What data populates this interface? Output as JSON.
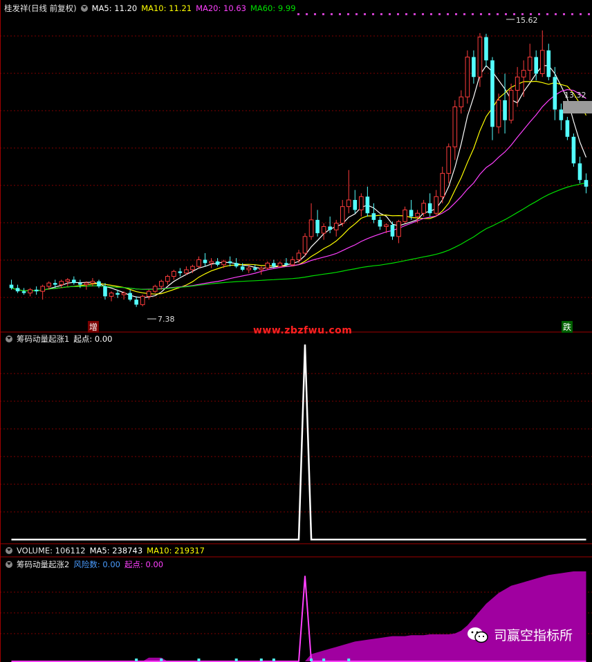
{
  "main_header": {
    "title": "桂发祥(日线 前复权)",
    "ma5_label": "MA5: 11.20",
    "ma10_label": "MA10: 11.21",
    "ma20_label": "MA20: 10.63",
    "ma60_label": "MA60: 9.99"
  },
  "annotations": {
    "high_label": "15.62",
    "low_label": "7.38",
    "price_label": "13.32",
    "up_tag": "增",
    "down_tag": "跌"
  },
  "watermark": "www.zbzfwu.com",
  "panel2_header": {
    "title": "筹码动量起涨1",
    "start_label": "起点: 0.00"
  },
  "panel3_header": {
    "volume_label": "VOLUME: 106112",
    "ma5_label": "MA5: 238743",
    "ma10_label": "MA10: 219317"
  },
  "panel4_header": {
    "title": "筹码动量起涨2",
    "risk_label": "风险数: 0.00",
    "start_label": "起点: 0.00"
  },
  "brand": "司赢空指标所",
  "colors": {
    "up": "#ff3c3c",
    "down": "#54ffff",
    "ma5": "#ffffff",
    "ma10": "#ffff00",
    "ma20": "#ff40ff",
    "ma60": "#00e000",
    "grid": "#800000",
    "signal": "#ffffff",
    "risk_fill": "#a000a0"
  },
  "chart_data": [
    {
      "type": "candlestick",
      "title": "桂发祥(日线 前复权)",
      "ylim": [
        7.0,
        16.2
      ],
      "candles": [
        [
          8.05,
          8.2,
          7.9,
          7.95
        ],
        [
          7.95,
          8.05,
          7.8,
          7.85
        ],
        [
          7.85,
          7.95,
          7.75,
          7.8
        ],
        [
          7.8,
          7.95,
          7.7,
          7.9
        ],
        [
          7.9,
          8.0,
          7.75,
          7.85
        ],
        [
          7.85,
          8.05,
          7.6,
          8.0
        ],
        [
          8.0,
          8.15,
          7.9,
          8.1
        ],
        [
          8.1,
          8.2,
          7.95,
          8.05
        ],
        [
          8.05,
          8.2,
          7.95,
          8.15
        ],
        [
          8.15,
          8.25,
          8.0,
          8.2
        ],
        [
          8.2,
          8.3,
          8.05,
          8.1
        ],
        [
          8.1,
          8.2,
          7.95,
          8.05
        ],
        [
          8.05,
          8.15,
          7.9,
          8.1
        ],
        [
          8.1,
          8.25,
          8.0,
          8.15
        ],
        [
          8.15,
          8.2,
          7.95,
          8.0
        ],
        [
          8.0,
          8.1,
          7.6,
          7.7
        ],
        [
          7.7,
          7.85,
          7.55,
          7.8
        ],
        [
          7.8,
          7.9,
          7.65,
          7.75
        ],
        [
          7.75,
          7.85,
          7.6,
          7.8
        ],
        [
          7.8,
          7.9,
          7.55,
          7.6
        ],
        [
          7.6,
          7.7,
          7.38,
          7.45
        ],
        [
          7.45,
          7.75,
          7.4,
          7.7
        ],
        [
          7.7,
          7.9,
          7.6,
          7.85
        ],
        [
          7.85,
          8.05,
          7.8,
          8.0
        ],
        [
          8.0,
          8.2,
          7.9,
          8.15
        ],
        [
          8.15,
          8.35,
          8.05,
          8.3
        ],
        [
          8.3,
          8.5,
          8.2,
          8.45
        ],
        [
          8.45,
          8.55,
          8.3,
          8.4
        ],
        [
          8.4,
          8.6,
          8.35,
          8.5
        ],
        [
          8.5,
          8.65,
          8.4,
          8.6
        ],
        [
          8.6,
          8.9,
          8.55,
          8.8
        ],
        [
          8.8,
          9.0,
          8.6,
          8.7
        ],
        [
          8.7,
          8.85,
          8.55,
          8.75
        ],
        [
          8.75,
          8.85,
          8.6,
          8.65
        ],
        [
          8.65,
          8.8,
          8.55,
          8.75
        ],
        [
          8.75,
          8.9,
          8.6,
          8.7
        ],
        [
          8.7,
          8.85,
          8.55,
          8.6
        ],
        [
          8.6,
          8.7,
          8.45,
          8.5
        ],
        [
          8.5,
          8.65,
          8.4,
          8.55
        ],
        [
          8.55,
          8.65,
          8.45,
          8.5
        ],
        [
          8.5,
          8.6,
          8.35,
          8.55
        ],
        [
          8.55,
          8.75,
          8.5,
          8.7
        ],
        [
          8.7,
          8.8,
          8.55,
          8.6
        ],
        [
          8.6,
          8.75,
          8.55,
          8.7
        ],
        [
          8.7,
          8.85,
          8.6,
          8.65
        ],
        [
          8.65,
          8.9,
          8.6,
          8.8
        ],
        [
          8.8,
          9.1,
          8.7,
          9.0
        ],
        [
          9.0,
          9.6,
          8.9,
          9.5
        ],
        [
          9.5,
          10.5,
          9.4,
          10.0
        ],
        [
          10.0,
          10.3,
          9.5,
          9.6
        ],
        [
          9.6,
          9.9,
          9.4,
          9.8
        ],
        [
          9.8,
          10.1,
          9.6,
          9.7
        ],
        [
          9.7,
          10.0,
          9.5,
          9.9
        ],
        [
          9.9,
          10.6,
          9.8,
          10.4
        ],
        [
          10.4,
          11.5,
          10.2,
          10.6
        ],
        [
          10.6,
          10.9,
          10.2,
          10.3
        ],
        [
          10.3,
          10.8,
          10.1,
          10.7
        ],
        [
          10.7,
          11.0,
          10.1,
          10.2
        ],
        [
          10.2,
          10.5,
          9.9,
          10.0
        ],
        [
          10.0,
          10.1,
          9.7,
          9.8
        ],
        [
          9.8,
          9.9,
          9.6,
          9.85
        ],
        [
          9.85,
          9.95,
          9.4,
          9.5
        ],
        [
          9.5,
          10.0,
          9.3,
          9.95
        ],
        [
          9.95,
          10.4,
          9.9,
          10.3
        ],
        [
          10.3,
          10.6,
          10.0,
          10.1
        ],
        [
          10.1,
          10.3,
          9.9,
          10.2
        ],
        [
          10.2,
          10.6,
          10.1,
          10.5
        ],
        [
          10.5,
          10.8,
          10.1,
          10.2
        ],
        [
          10.2,
          10.9,
          10.1,
          10.7
        ],
        [
          10.7,
          11.6,
          10.5,
          11.4
        ],
        [
          11.4,
          12.3,
          11.1,
          12.2
        ],
        [
          12.2,
          13.6,
          11.8,
          13.4
        ],
        [
          13.4,
          13.9,
          13.2,
          13.7
        ],
        [
          13.7,
          15.1,
          13.5,
          14.9
        ],
        [
          14.9,
          15.1,
          14.1,
          14.3
        ],
        [
          14.3,
          15.62,
          14.0,
          15.5
        ],
        [
          15.5,
          15.6,
          14.6,
          14.8
        ],
        [
          14.8,
          14.9,
          12.4,
          12.8
        ],
        [
          12.8,
          13.8,
          12.6,
          13.6
        ],
        [
          13.6,
          14.4,
          12.6,
          13.0
        ],
        [
          13.0,
          14.1,
          12.9,
          13.9
        ],
        [
          13.9,
          14.6,
          13.4,
          14.3
        ],
        [
          14.3,
          14.8,
          13.7,
          14.5
        ],
        [
          14.5,
          15.3,
          14.2,
          14.9
        ],
        [
          14.9,
          15.1,
          14.2,
          14.4
        ],
        [
          14.4,
          15.7,
          14.3,
          15.1
        ],
        [
          15.1,
          15.3,
          14.2,
          14.3
        ],
        [
          14.3,
          14.6,
          13.0,
          13.32
        ],
        [
          13.32,
          13.5,
          12.7,
          13.0
        ],
        [
          13.0,
          13.1,
          12.4,
          12.5
        ],
        [
          12.5,
          12.6,
          11.6,
          11.7
        ],
        [
          11.7,
          11.9,
          11.1,
          11.2
        ],
        [
          11.2,
          11.4,
          10.8,
          11.0
        ]
      ]
    },
    {
      "type": "line",
      "title": "筹码动量起涨1",
      "ylim": [
        0,
        1
      ],
      "series": [
        {
          "name": "起点",
          "values": [
            0,
            0,
            0,
            0,
            0,
            0,
            0,
            0,
            0,
            0,
            0,
            0,
            0,
            0,
            0,
            0,
            0,
            0,
            0,
            0,
            0,
            0,
            0,
            0,
            0,
            0,
            0,
            0,
            0,
            0,
            0,
            0,
            0,
            0,
            0,
            0,
            0,
            0,
            0,
            0,
            0,
            0,
            0,
            0,
            0,
            0,
            0,
            1,
            0,
            0,
            0,
            0,
            0,
            0,
            0,
            0,
            0,
            0,
            0,
            0,
            0,
            0,
            0,
            0,
            0,
            0,
            0,
            0,
            0,
            0,
            0,
            0,
            0,
            0,
            0,
            0,
            0,
            0,
            0,
            0,
            0,
            0,
            0,
            0,
            0,
            0,
            0,
            0,
            0,
            0,
            0,
            0,
            0
          ]
        }
      ]
    },
    {
      "type": "area",
      "title": "筹码动量起涨2",
      "ylim": [
        0,
        100
      ],
      "series": [
        {
          "name": "风险数",
          "values": [
            0,
            0,
            0,
            0,
            0,
            0,
            0,
            0,
            0,
            0,
            0,
            0,
            0,
            0,
            0,
            0,
            0,
            0,
            0,
            0,
            0,
            0,
            4,
            4,
            4,
            0,
            0,
            0,
            0,
            0,
            0,
            0,
            0,
            0,
            0,
            0,
            0,
            0,
            0,
            0,
            0,
            0,
            0,
            0,
            0,
            0,
            0,
            0,
            8,
            10,
            12,
            14,
            16,
            18,
            20,
            22,
            23,
            24,
            25,
            26,
            27,
            28,
            28,
            28,
            29,
            29,
            29,
            30,
            30,
            30,
            30,
            31,
            34,
            40,
            48,
            56,
            64,
            70,
            76,
            80,
            84,
            86,
            88,
            90,
            92,
            94,
            96,
            97,
            98,
            99,
            100,
            100,
            100
          ]
        },
        {
          "name": "起点",
          "values": [
            0,
            0,
            0,
            0,
            0,
            0,
            0,
            0,
            0,
            0,
            0,
            0,
            0,
            0,
            0,
            0,
            0,
            0,
            0,
            0,
            0,
            0,
            0,
            0,
            0,
            0,
            0,
            0,
            0,
            0,
            0,
            0,
            0,
            0,
            0,
            0,
            0,
            0,
            0,
            0,
            0,
            0,
            0,
            0,
            0,
            0,
            0,
            95,
            0,
            0,
            0,
            0,
            0,
            0,
            0,
            0,
            0,
            0,
            0,
            0,
            0,
            0,
            0,
            0,
            0,
            0,
            0,
            0,
            0,
            0,
            0,
            0,
            0,
            0,
            0,
            0,
            0,
            0,
            0,
            0,
            0,
            0,
            0,
            0,
            0,
            0,
            0,
            0,
            0,
            0,
            0,
            0,
            0
          ]
        }
      ]
    }
  ]
}
